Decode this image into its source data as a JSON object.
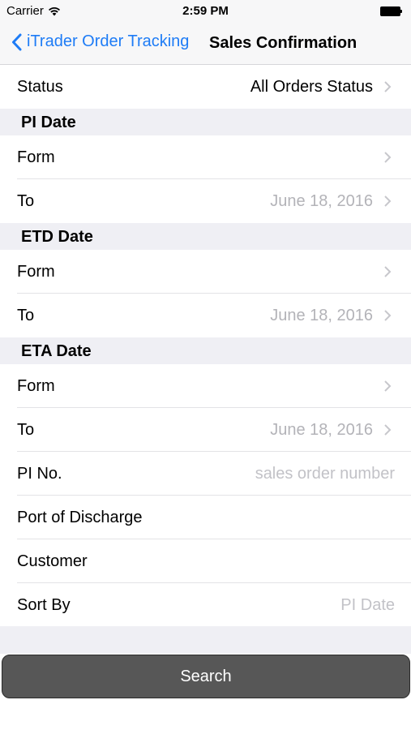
{
  "status_bar": {
    "carrier": "Carrier",
    "time": "2:59 PM"
  },
  "nav": {
    "back_label": "iTrader Order Tracking",
    "title": "Sales Confirmation"
  },
  "rows": {
    "status": {
      "label": "Status",
      "value": "All Orders Status"
    },
    "pi_date": {
      "header": "PI Date",
      "from_label": "Form",
      "from_value": "",
      "to_label": "To",
      "to_value": "June 18, 2016"
    },
    "etd_date": {
      "header": "ETD Date",
      "from_label": "Form",
      "from_value": "",
      "to_label": "To",
      "to_value": "June 18, 2016"
    },
    "eta_date": {
      "header": "ETA Date",
      "from_label": "Form",
      "from_value": "",
      "to_label": "To",
      "to_value": "June 18, 2016"
    },
    "pi_no": {
      "label": "PI No.",
      "placeholder": "sales order number"
    },
    "port": {
      "label": "Port of Discharge",
      "value": ""
    },
    "customer": {
      "label": "Customer",
      "value": ""
    },
    "sort_by": {
      "label": "Sort By",
      "value": "PI Date"
    }
  },
  "search_button": {
    "label": "Search"
  },
  "icons": {
    "wifi": "wifi-icon",
    "battery": "battery-icon",
    "back": "chevron-left-icon",
    "disclosure": "chevron-right-icon"
  },
  "colors": {
    "accent": "#1e7cf6",
    "section_bg": "#efeff4",
    "button_bg": "#575757",
    "placeholder": "#c2c2c7"
  }
}
